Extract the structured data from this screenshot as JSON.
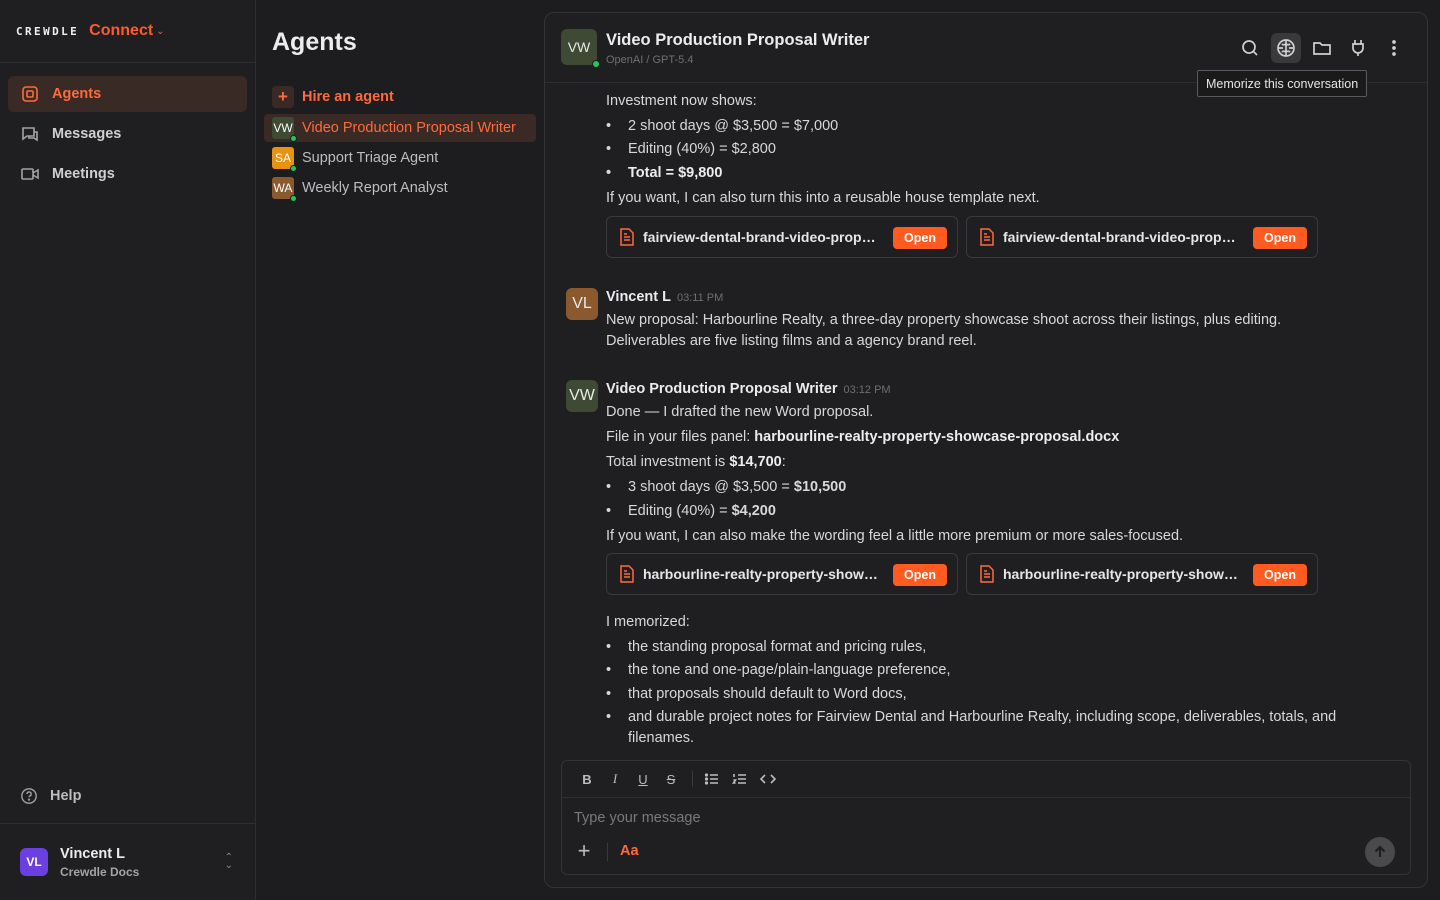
{
  "brand": {
    "wordmark": "CREWDLE",
    "product": "Connect"
  },
  "nav": [
    {
      "label": "Agents",
      "icon": "agents-icon",
      "active": true
    },
    {
      "label": "Messages",
      "icon": "messages-icon"
    },
    {
      "label": "Meetings",
      "icon": "meetings-icon"
    }
  ],
  "help_label": "Help",
  "user": {
    "initials": "VL",
    "name": "Vincent L",
    "org": "Crewdle Docs"
  },
  "agents_panel": {
    "title": "Agents",
    "hire_label": "Hire an agent",
    "agents": [
      {
        "initials": "VW",
        "name": "Video Production Proposal Writer",
        "color": "#3e4a33",
        "active": true
      },
      {
        "initials": "SA",
        "name": "Support Triage Agent",
        "color": "#e8930f"
      },
      {
        "initials": "WA",
        "name": "Weekly Report Analyst",
        "color": "#8a5a2e"
      }
    ]
  },
  "chat": {
    "header": {
      "initials": "VW",
      "title": "Video Production Proposal Writer",
      "subtitle": "OpenAI / GPT-5.4"
    },
    "tooltip": "Memorize this conversation",
    "prev": {
      "line1": "Investment now shows:",
      "bullets": [
        "2 shoot days @ $3,500 = $7,000",
        "Editing (40%) = $2,800",
        "Total = $9,800"
      ],
      "line2": "If you want, I can also turn this into a reusable house template next.",
      "files": [
        "fairview-dental-brand-video-proposal.docx",
        "fairview-dental-brand-video-proposal.pdf"
      ]
    },
    "user_msg": {
      "initials": "VL",
      "name": "Vincent L",
      "time": "03:11 PM",
      "line1": "New proposal: Harbourline Realty, a three-day property showcase shoot across their listings, plus editing.",
      "line2": "Deliverables are five listing films and a agency brand reel."
    },
    "agent_msg": {
      "initials": "VW",
      "name": "Video Production Proposal Writer",
      "time": "03:12 PM",
      "line1": "Done — I drafted the new Word proposal.",
      "file_prefix": "File in your files panel: ",
      "file_name": "harbourline-realty-property-showcase-proposal.docx",
      "total_prefix": "Total investment is ",
      "total_value": "$14,700",
      "total_suffix": ":",
      "b1_prefix": "3 shoot days @ $3,500 = ",
      "b1_value": "$10,500",
      "b2_prefix": "Editing (40%) = ",
      "b2_value": "$4,200",
      "line_after": "If you want, I can also make the wording feel a little more premium or more sales-focused.",
      "files": [
        "harbourline-realty-property-showcase-proposal.docx",
        "harbourline-realty-property-showcase-proposal.pdf"
      ],
      "open_label": "Open",
      "memorized_title": "I memorized:",
      "memorized": [
        "the standing proposal format and pricing rules,",
        "the tone and one-page/plain-language preference,",
        "that proposals should default to Word docs,",
        "and durable project notes for Fairview Dental and Harbourline Realty, including scope, deliverables, totals, and",
        "filenames."
      ]
    }
  },
  "composer": {
    "placeholder": "Type your message",
    "aa_label": "Aa"
  },
  "format_buttons": {
    "bold": "B",
    "italic": "I",
    "underline": "U",
    "strike": "S"
  }
}
